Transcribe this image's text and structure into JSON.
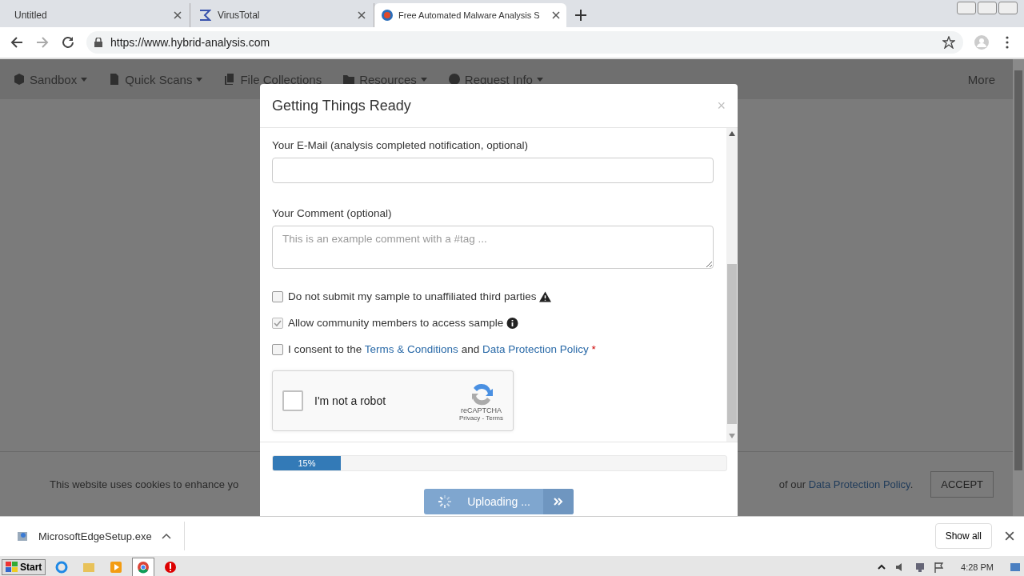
{
  "browser": {
    "tabs": [
      {
        "title": "Untitled",
        "kind": "plain",
        "selected": false
      },
      {
        "title": "VirusTotal",
        "kind": "sigma",
        "selected": false
      },
      {
        "title": "Free Automated Malware Analysis S",
        "kind": "globe",
        "selected": true
      }
    ],
    "url": "https://www.hybrid-analysis.com"
  },
  "nav": {
    "items": [
      {
        "label": "Sandbox",
        "kind": "cube",
        "dropdown": true
      },
      {
        "label": "Quick Scans",
        "kind": "file",
        "dropdown": true
      },
      {
        "label": "File Collections",
        "kind": "files",
        "dropdown": false
      },
      {
        "label": "Resources",
        "kind": "folder",
        "dropdown": true
      },
      {
        "label": "Request Info",
        "kind": "question",
        "dropdown": true
      }
    ],
    "more": "More"
  },
  "cookie_bar": {
    "text": "This website uses cookies to enhance yo",
    "text_end": "of our",
    "link": "Data Protection Policy",
    "suffix": ".",
    "accept": "ACCEPT"
  },
  "modal": {
    "title": "Getting Things Ready",
    "close": "×",
    "email": {
      "label": "Your E-Mail (analysis completed notification, optional)"
    },
    "comment": {
      "label": "Your Comment (optional)",
      "placeholder": "This is an example comment with a #tag ..."
    },
    "options": [
      {
        "kind": "warning",
        "checked": false,
        "disabled": false,
        "parts": [
          {
            "kind": "text",
            "text": "Do not submit my sample to unaffiliated third parties"
          }
        ]
      },
      {
        "kind": "info",
        "checked": true,
        "disabled": true,
        "parts": [
          {
            "kind": "text",
            "text": "Allow community members to access sample"
          }
        ]
      },
      {
        "kind": "plain",
        "checked": false,
        "disabled": false,
        "parts": [
          {
            "kind": "text",
            "text": "I consent to the"
          },
          {
            "kind": "link",
            "text": "Terms & Conditions"
          },
          {
            "kind": "text",
            "text": "and"
          },
          {
            "kind": "link",
            "text": "Data Protection Policy"
          },
          {
            "kind": "required",
            "text": "*"
          }
        ]
      }
    ],
    "captcha": {
      "label": "I'm not a robot",
      "checked": false,
      "brand": "reCAPTCHA",
      "links": "Privacy - Terms"
    },
    "progress": {
      "level": 0.15,
      "label": "15%"
    },
    "submit": {
      "label": "Uploading ...",
      "busy": true
    }
  },
  "downloads": {
    "file": "MicrosoftEdgeSetup.exe",
    "show_all": "Show all"
  },
  "taskbar": {
    "start": "Start",
    "apps": [
      {
        "kind": "ie",
        "selected": false
      },
      {
        "kind": "explorer",
        "selected": false
      },
      {
        "kind": "media",
        "selected": false
      },
      {
        "kind": "chrome",
        "selected": true
      },
      {
        "kind": "stop",
        "selected": false
      }
    ],
    "clock": "4:28 PM"
  }
}
